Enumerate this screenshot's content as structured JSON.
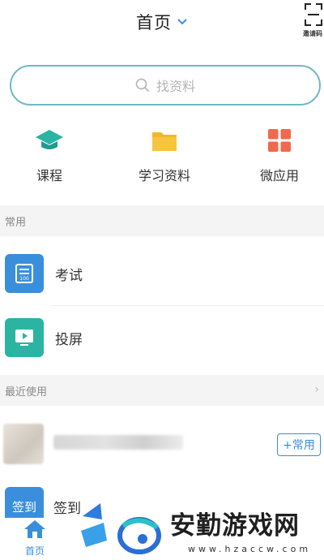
{
  "header": {
    "title": "首页",
    "invite_label": "邀请码"
  },
  "search": {
    "placeholder": "找资料"
  },
  "quick": [
    {
      "label": "课程",
      "icon": "graduation-cap-icon",
      "color": "#2bb4a2"
    },
    {
      "label": "学习资料",
      "icon": "folder-icon",
      "color": "#f5b824"
    },
    {
      "label": "微应用",
      "icon": "apps-grid-icon",
      "color": "#ef6a4c"
    }
  ],
  "sections": {
    "common": "常用",
    "recent": "最近使用"
  },
  "common_items": [
    {
      "label": "考试",
      "icon": "exam-icon",
      "color": "#3a8fdc"
    },
    {
      "label": "投屏",
      "icon": "screen-cast-icon",
      "color": "#2bb4a2"
    }
  ],
  "recent": {
    "add_button": "+常用"
  },
  "checkin": {
    "icon_text": "签到",
    "label": "签到"
  },
  "tabbar": {
    "home_label": "首页"
  },
  "watermark": {
    "text": "安勤游戏网",
    "url": "www.hzaccw.com"
  },
  "colors": {
    "accent": "#3a8fdc",
    "search_border": "#6fb8c4"
  }
}
